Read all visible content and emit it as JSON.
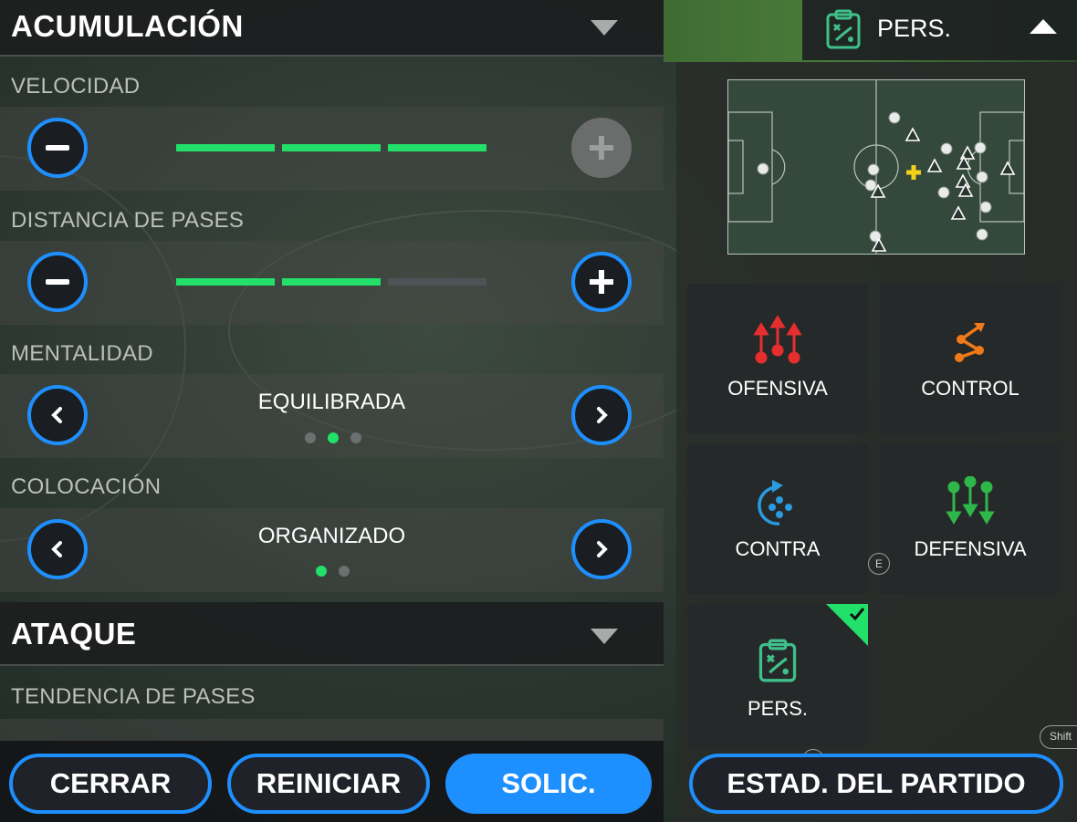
{
  "left_panel": {
    "section1": {
      "title": "ACUMULACIÓN"
    },
    "section2": {
      "title": "ATAQUE"
    },
    "settings": [
      {
        "label": "VELOCIDAD",
        "bar_levels": [
          1,
          1,
          1
        ],
        "plus_enabled": false
      },
      {
        "label": "DISTANCIA DE PASES",
        "bar_levels": [
          1,
          1,
          0
        ],
        "plus_enabled": true
      },
      {
        "label": "MENTALIDAD",
        "value": "EQUILIBRADA",
        "dots_total": 3,
        "dots_active": 2
      },
      {
        "label": "COLOCACIÓN",
        "value": "ORGANIZADO",
        "dots_total": 2,
        "dots_active": 1
      },
      {
        "label": "TENDENCIA DE PASES"
      }
    ],
    "buttons": {
      "close": "CERRAR",
      "reset": "REINICIAR",
      "apply": "SOLIC."
    }
  },
  "right_panel": {
    "header": {
      "label": "PERS."
    },
    "styles": [
      {
        "label": "OFENSIVA",
        "icon": "offensive-arrows-icon"
      },
      {
        "label": "CONTROL",
        "icon": "control-path-icon"
      },
      {
        "label": "CONTRA",
        "icon": "counter-icon"
      },
      {
        "label": "DEFENSIVA",
        "icon": "defensive-arrows-icon"
      },
      {
        "label": "PERS.",
        "icon": "clipboard-tactics-icon",
        "selected": true
      }
    ],
    "stats_button": "ESTAD. DEL PARTIDO",
    "key_hints": {
      "e": "E",
      "q": "Q",
      "shift": "Shift"
    }
  },
  "colors": {
    "accent": "#1e8fff",
    "bar_active": "#22e06a",
    "bar_inactive": "#4e5358",
    "offensive": "#e62e2e",
    "control": "#f07a1a",
    "counter": "#2a9be0",
    "defensive": "#2fb84a",
    "pers": "#3fc08a",
    "selected_corner": "#22e06a"
  }
}
